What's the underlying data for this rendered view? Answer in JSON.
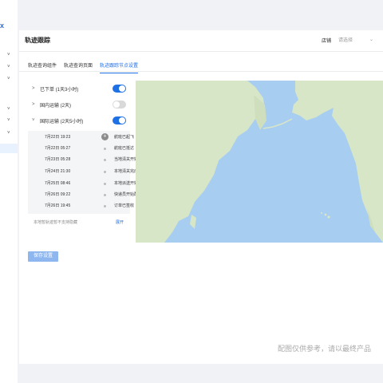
{
  "nav": {
    "logo_fragment": "x",
    "chevrons": [
      "˅",
      "˅",
      "˅",
      "˅",
      "˅",
      "˅",
      "˅"
    ]
  },
  "header": {
    "title": "轨迹跟踪",
    "store_label": "店铺",
    "store_placeholder": "请选择"
  },
  "tabs": [
    {
      "label": "轨迹查询组件",
      "active": false
    },
    {
      "label": "轨迹查询页面",
      "active": false
    },
    {
      "label": "轨迹跟踪节点设置",
      "active": true
    }
  ],
  "nodes": [
    {
      "label": "已下单 (1天3小时)",
      "expanded": false,
      "enabled": true,
      "chevron": ">"
    },
    {
      "label": "国内运输 (2天)",
      "expanded": false,
      "enabled": false,
      "chevron": ">"
    },
    {
      "label": "国际运输 (2天5小时)",
      "expanded": true,
      "enabled": true,
      "chevron": "˅"
    }
  ],
  "timeline": [
    {
      "date": "7月22日 19:23",
      "event": "航班已起飞",
      "current": true
    },
    {
      "date": "7月22日 05:27",
      "event": "航班已抵达",
      "current": false
    },
    {
      "date": "7月23日 05:28",
      "event": "当地清关开始",
      "current": false
    },
    {
      "date": "7月24日 21:30",
      "event": "本地清关完成",
      "current": false
    },
    {
      "date": "7月25日 08:46",
      "event": "本地派送开始",
      "current": false
    },
    {
      "date": "7月26日 09:22",
      "event": "快递员开始配送",
      "current": false
    },
    {
      "date": "7月26日 19:45",
      "event": "订单已签收",
      "current": false
    }
  ],
  "note": "本地暂轨迹暂不支持隐藏",
  "expand_label": "展开",
  "save_label": "保存设置",
  "disclaimer": "配图仅供参考，请以最终产品",
  "colors": {
    "accent": "#1f6fe5",
    "ocean": "#a7cdf0",
    "land": "#d8e6c8"
  }
}
